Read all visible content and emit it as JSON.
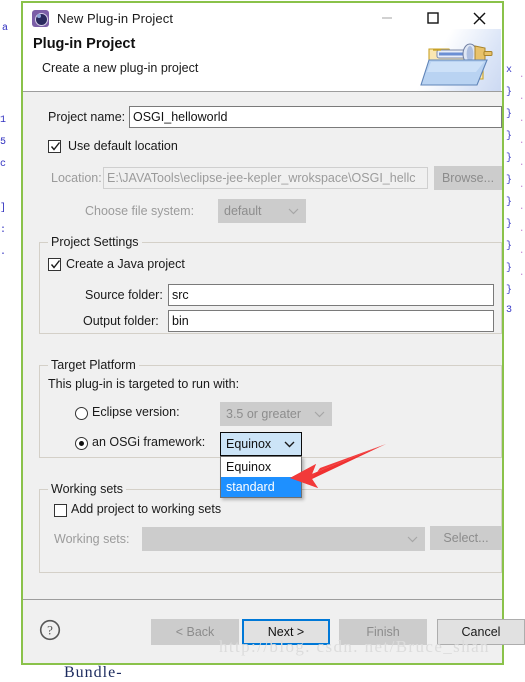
{
  "window": {
    "title": "New Plug-in Project",
    "icon": "plugin-gear-icon",
    "minimize_label": "—",
    "maximize_label": "□",
    "close_label": "✕"
  },
  "banner": {
    "title": "Plug-in Project",
    "subtitle": "Create a new plug-in project",
    "image": "plugin-folder-icon"
  },
  "form": {
    "project_name_label": "Project name:",
    "project_name_value": "OSGI_helloworld",
    "use_default_location_label": "Use default location",
    "use_default_location_checked": true,
    "location_label": "Location:",
    "location_value": "E:\\JAVATools\\eclipse-jee-kepler_wrokspace\\OSGI_hellc",
    "browse_label": "Browse...",
    "choose_file_system_label": "Choose file system:",
    "choose_file_system_value": "default"
  },
  "project_settings": {
    "group_title": "Project Settings",
    "create_java_project_label": "Create a Java project",
    "create_java_project_checked": true,
    "source_folder_label": "Source folder:",
    "source_folder_value": "src",
    "output_folder_label": "Output folder:",
    "output_folder_value": "bin"
  },
  "target_platform": {
    "group_title": "Target Platform",
    "intro": "This plug-in is targeted to run with:",
    "eclipse_version_label": "Eclipse version:",
    "eclipse_version_value": "3.5 or greater",
    "eclipse_version_selected": false,
    "osgi_framework_label": "an OSGi framework:",
    "osgi_framework_value": "Equinox",
    "osgi_framework_selected": true,
    "dropdown_open": true,
    "dropdown_options": [
      {
        "label": "Equinox",
        "selected": false
      },
      {
        "label": "standard",
        "selected": true
      }
    ]
  },
  "working_sets": {
    "group_title": "Working sets",
    "add_project_label": "Add project to working sets",
    "add_project_checked": false,
    "working_sets_label": "Working sets:",
    "working_sets_value": "",
    "select_label": "Select..."
  },
  "buttons": {
    "help": "?",
    "back": "< Back",
    "next": "Next >",
    "finish": "Finish",
    "cancel": "Cancel"
  },
  "annotations": {
    "arrow": "red-arrow-pointing-to-standard-option",
    "watermark": "http://blog. csdn. net/Bruce_shan"
  },
  "background": {
    "editor_text": "Bundle-",
    "left_glyphs": "a\n\n\n\n\n\n\n\n\n\n\n\n\n\n",
    "colors": {
      "dialog_border": "#8ac24a",
      "accent": "#0078d7",
      "selection": "#1e90ff",
      "combo_focus": "#cce4f7",
      "arrow_red": "#f03030"
    }
  }
}
